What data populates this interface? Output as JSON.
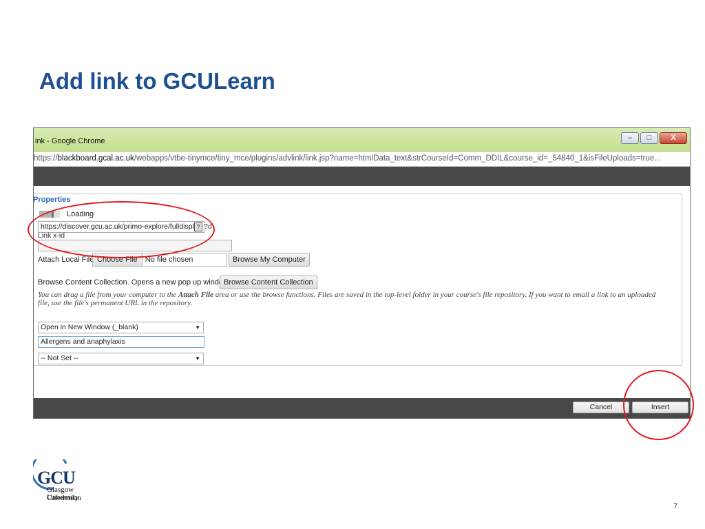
{
  "slide": {
    "title": "Add link to GCULearn",
    "page_number": "7"
  },
  "window": {
    "title": "ink - Google Chrome",
    "controls": {
      "minimize": "–",
      "maximize": "□",
      "close": "X"
    },
    "address": {
      "scheme": "https://",
      "host": "blackboard.gcal.ac.uk",
      "path": "/webapps/vtbe-tinymce/tiny_mce/plugins/advlink/link.jsp?name=htmlData_text&strCourseId=Comm_DDIL&course_id=_54840_1&isFileUploads=true..."
    }
  },
  "form": {
    "legend": "Properties",
    "loading_label": "Loading",
    "url_value": "https://discover.gcu.ac.uk/primo-explore/fulldispla",
    "url_tail": "?d",
    "url_help_icon": "?",
    "link_xid_label": "Link x-id",
    "attach_label": "Attach Local File",
    "choose_file_label": "Choose File",
    "no_file_label": "No file chosen",
    "browse_computer_label": "Browse My Computer",
    "browse_collection_text": "Browse Content Collection. Opens a new pop up window.",
    "browse_collection_button": "Browse Content Collection",
    "help_text_1": "You can drag a file from your computer to the ",
    "help_text_bold": "Attach File",
    "help_text_2": " area or use the browse functions. Files are saved in the top-level folder in your course's file repository. If you want to email a link to an uploaded file, use the file's permanent URL in the repository.",
    "target_value": "Open in New Window (_blank)",
    "link_name_value": "Allergens and anaphylaxis",
    "class_value": "-- Not Set --"
  },
  "footer": {
    "cancel_label": "Cancel",
    "insert_label": "Insert"
  },
  "logo": {
    "text": "GCU",
    "line1": "Glasgow Caledonian",
    "line2": "University"
  },
  "colors": {
    "title": "#1d4f91",
    "annotation_ring": "#e0191f",
    "legend": "#2b6ab3"
  }
}
